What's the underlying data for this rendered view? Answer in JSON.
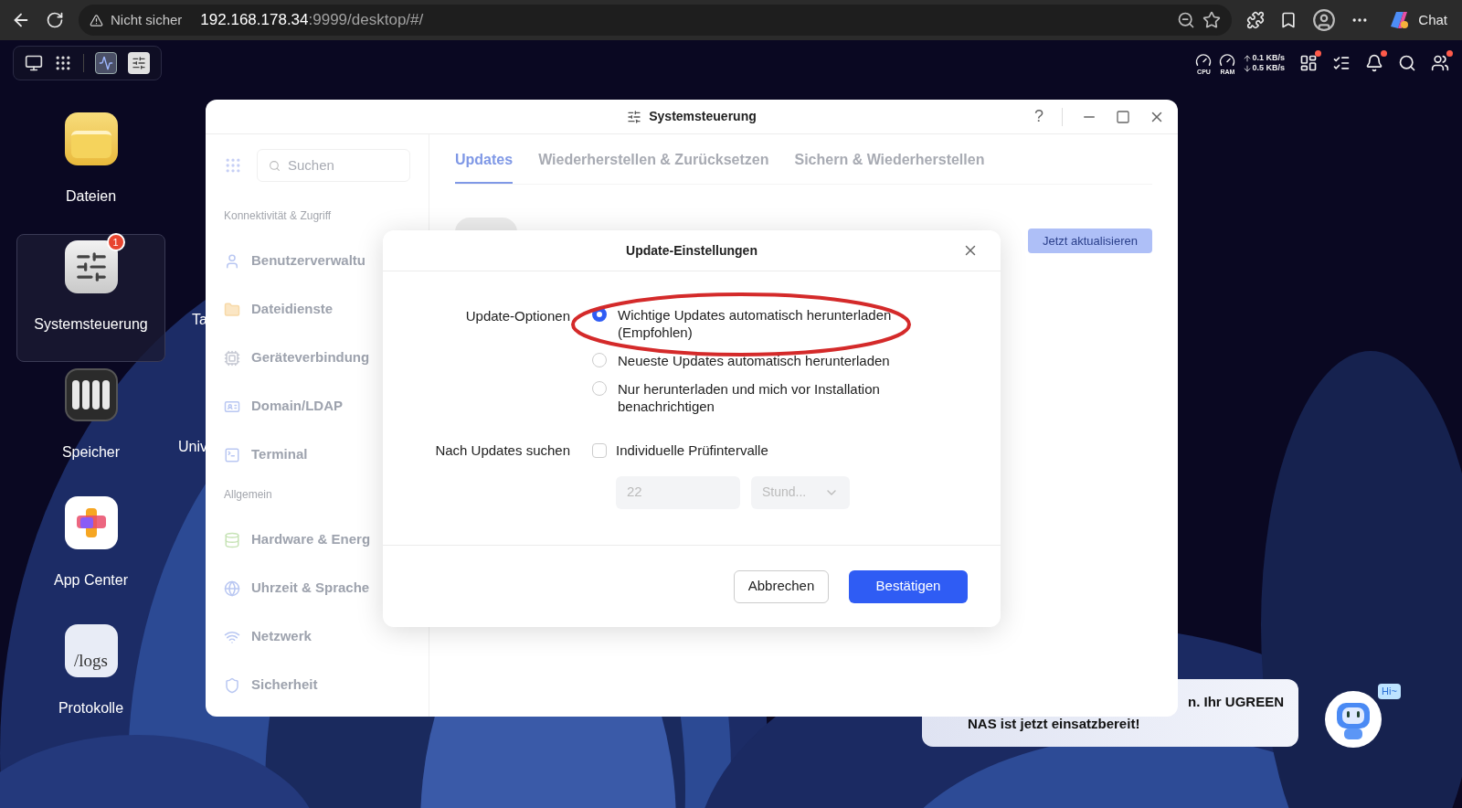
{
  "browser": {
    "security": "Nicht sicher",
    "url_host": "192.168.178.34",
    "url_rest": ":9999/desktop/#/",
    "chat_button": "Chat"
  },
  "topbar": {
    "cpu": "CPU",
    "ram": "RAM",
    "upload": "0.1 KB/s",
    "download": "0.5 KB/s"
  },
  "desktop_icons": [
    {
      "label": "Dateien",
      "kind": "folder",
      "selected": false
    },
    {
      "label": "Systemsteuerung",
      "kind": "settings",
      "selected": true,
      "badge": "1"
    },
    {
      "label": "Speicher",
      "kind": "storage",
      "selected": false
    },
    {
      "label": "App Center",
      "kind": "apps",
      "selected": false
    },
    {
      "label": "Protokolle",
      "kind": "logs",
      "selected": false,
      "icon_text": "/logs"
    }
  ],
  "hidden_icon_labels": [
    "Ta",
    "Univ"
  ],
  "window": {
    "title": "Systemsteuerung",
    "help": "?"
  },
  "sidebar": {
    "search_placeholder": "Suchen",
    "sections": [
      {
        "heading": "Konnektivität & Zugriff",
        "items": [
          {
            "label": "Benutzerverwaltu",
            "kind": "user"
          },
          {
            "label": "Dateidienste",
            "kind": "folder"
          },
          {
            "label": "Geräteverbindung",
            "kind": "device"
          },
          {
            "label": "Domain/LDAP",
            "kind": "domain"
          },
          {
            "label": "Terminal",
            "kind": "terminal"
          }
        ]
      },
      {
        "heading": "Allgemein",
        "items": [
          {
            "label": "Hardware & Energ",
            "kind": "hardware"
          },
          {
            "label": "Uhrzeit & Sprache",
            "kind": "time"
          },
          {
            "label": "Netzwerk",
            "kind": "network"
          },
          {
            "label": "Sicherheit",
            "kind": "security"
          }
        ]
      }
    ]
  },
  "tabs": [
    {
      "label": "Updates",
      "selected": true
    },
    {
      "label": "Wiederherstellen & Zurücksetzen",
      "selected": false
    },
    {
      "label": "Sichern & Wiederherstellen",
      "selected": false
    }
  ],
  "update_button": "Jetzt aktualisieren",
  "dialog": {
    "title": "Update-Einstellungen",
    "options_label": "Update-Optionen",
    "options": [
      {
        "label": "Wichtige Updates automatisch herunterladen (Empfohlen)",
        "selected": true,
        "highlighted": true
      },
      {
        "label": "Neueste Updates automatisch herunterladen",
        "selected": false,
        "highlighted": false
      },
      {
        "label": "Nur herunterladen und mich vor Installation benachrichtigen",
        "selected": false,
        "highlighted": false
      }
    ],
    "check_label": "Nach Updates suchen",
    "custom_interval": {
      "label": "Individuelle Prüfintervalle",
      "checked": false
    },
    "interval": {
      "value": "22",
      "disabled": true
    },
    "unit": {
      "value": "Stund...",
      "disabled": true
    },
    "cancel": "Abbrechen",
    "confirm": "Bestätigen"
  },
  "notification": {
    "line_1": "n. Ihr UGREEN",
    "line_2": "NAS ist jetzt einsatzbereit!",
    "assistant_badge": "Hi~"
  }
}
